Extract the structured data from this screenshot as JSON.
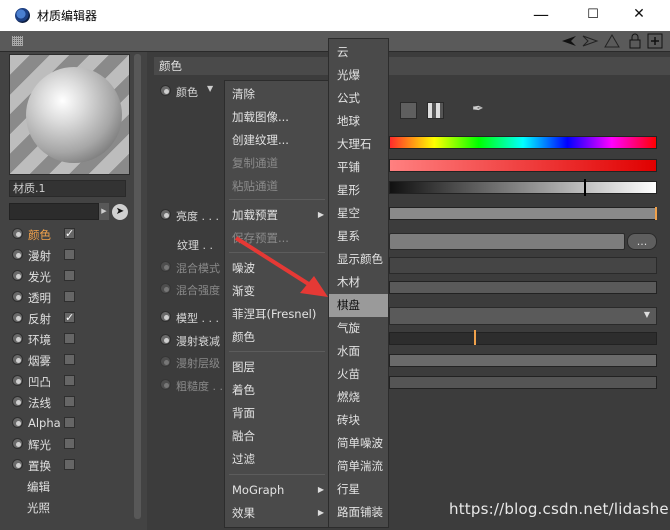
{
  "window": {
    "title": "材质编辑器",
    "min_glyph": "—",
    "max_glyph": "☐",
    "close_glyph": "✕"
  },
  "toolbar": {
    "icons": [
      "back-arrow-icon",
      "forward-arrow-icon",
      "node-icon",
      "lock-icon",
      "add-icon"
    ]
  },
  "material": {
    "name": "材质.1"
  },
  "channels": [
    {
      "label": "颜色",
      "checked": true,
      "active": true
    },
    {
      "label": "漫射",
      "checked": false
    },
    {
      "label": "发光",
      "checked": false
    },
    {
      "label": "透明",
      "checked": false
    },
    {
      "label": "反射",
      "checked": true
    },
    {
      "label": "环境",
      "checked": false
    },
    {
      "label": "烟雾",
      "checked": false
    },
    {
      "label": "凹凸",
      "checked": false
    },
    {
      "label": "法线",
      "checked": false
    },
    {
      "label": "Alpha",
      "checked": false
    },
    {
      "label": "辉光",
      "checked": false
    },
    {
      "label": "置换",
      "checked": false
    }
  ],
  "extra_items": [
    "编辑",
    "光照"
  ],
  "right": {
    "section_title": "颜色",
    "props": {
      "color": "颜色",
      "brightness": "亮度 . . .",
      "texture": "纹理 . .",
      "mix_mode": "混合模式",
      "mix_strength": "混合强度",
      "model": "模型 . . .",
      "diffuse_falloff": "漫射衰减",
      "diffuse_level": "漫射层级",
      "roughness": "粗糙度 . ."
    },
    "more_button": "..."
  },
  "context_menu": {
    "group1": [
      {
        "label": "清除",
        "disabled": false
      },
      {
        "label": "加载图像...",
        "disabled": false
      },
      {
        "label": "创建纹理...",
        "disabled": false
      },
      {
        "label": "复制通道",
        "disabled": true
      },
      {
        "label": "粘贴通道",
        "disabled": true
      }
    ],
    "group2": [
      {
        "label": "加载预置",
        "disabled": false,
        "submenu": true
      },
      {
        "label": "保存预置...",
        "disabled": true
      }
    ],
    "group3": [
      {
        "label": "噪波",
        "disabled": false
      },
      {
        "label": "渐变",
        "disabled": false
      },
      {
        "label": "菲涅耳(Fresnel)",
        "disabled": false
      },
      {
        "label": "颜色",
        "disabled": false
      }
    ],
    "group4": [
      {
        "label": "图层",
        "disabled": false
      },
      {
        "label": "着色",
        "disabled": false
      },
      {
        "label": "背面",
        "disabled": false
      },
      {
        "label": "融合",
        "disabled": false
      },
      {
        "label": "过滤",
        "disabled": false
      }
    ],
    "group5": [
      {
        "label": "MoGraph",
        "disabled": false,
        "submenu": true
      },
      {
        "label": "效果",
        "disabled": false,
        "submenu": true
      }
    ]
  },
  "submenu": {
    "items": [
      "云",
      "光爆",
      "公式",
      "地球",
      "大理石",
      "平铺",
      "星形",
      "星空",
      "星系",
      "显示颜色",
      "木材",
      "棋盘",
      "气旋",
      "水面",
      "火苗",
      "燃烧",
      "砖块",
      "简单噪波",
      "简单湍流",
      "行星",
      "路面铺装"
    ],
    "highlighted": "棋盘"
  },
  "watermark": "https://blog.csdn.net/lidashent",
  "colors": {
    "accent": "#f0a14b",
    "menu_bg": "#4a4a4a",
    "highlight": "#9a9a9a",
    "arrow": "#e53935"
  }
}
